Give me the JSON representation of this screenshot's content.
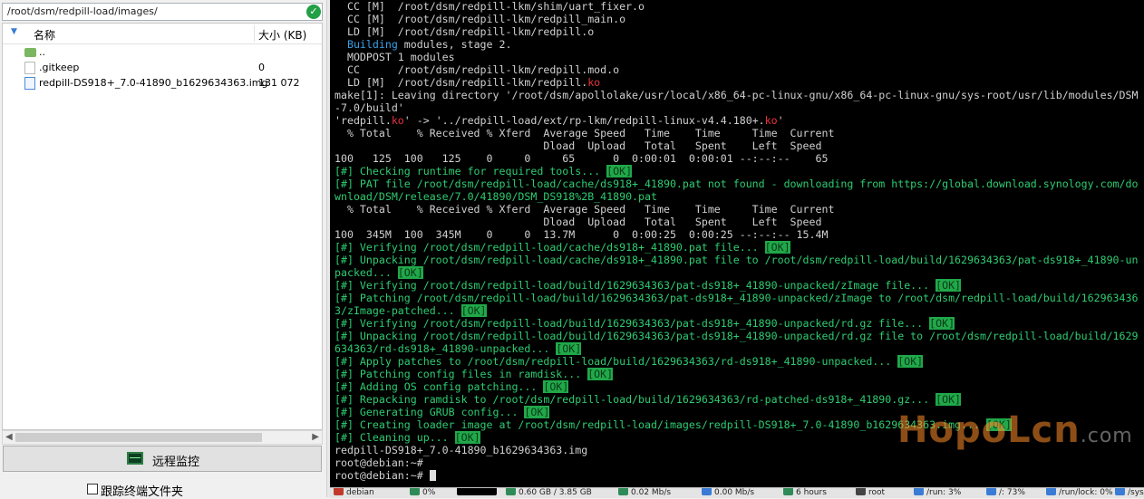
{
  "file_panel": {
    "path": "/root/dsm/redpill-load/images/",
    "columns": {
      "name": "名称",
      "size": "大小 (KB)"
    },
    "files": [
      {
        "name": "..",
        "size": "",
        "icon": "folder-up-icon"
      },
      {
        "name": ".gitkeep",
        "size": "0",
        "icon": "file-icon"
      },
      {
        "name": "redpill-DS918+_7.0-41890_b1629634363.img",
        "size": "131 072",
        "icon": "image-file-icon"
      }
    ],
    "remote_monitor_label": "远程监控",
    "follow_terminal_label": "跟踪终端文件夹"
  },
  "terminal": {
    "lines": [
      [
        {
          "t": "  CC [M]  /root/dsm/redpill-lkm/shim/uart_fixer.o"
        }
      ],
      [
        {
          "t": "  CC [M]  /root/dsm/redpill-lkm/redpill_main.o"
        }
      ],
      [
        {
          "t": "  LD [M]  /root/dsm/redpill-lkm/redpill.o"
        }
      ],
      [
        {
          "t": "  "
        },
        {
          "t": "Building",
          "c": "b"
        },
        {
          "t": " modules, stage 2."
        }
      ],
      [
        {
          "t": "  MODPOST 1 modules"
        }
      ],
      [
        {
          "t": "  CC      /root/dsm/redpill-lkm/redpill.mod.o"
        }
      ],
      [
        {
          "t": "  LD [M]  /root/dsm/redpill-lkm/redpill."
        },
        {
          "t": "ko",
          "c": "r"
        }
      ],
      [
        {
          "t": "make[1]: Leaving directory '/root/dsm/apollolake/usr/local/x86_64-pc-linux-gnu/x86_64-pc-linux-gnu/sys-root/usr/lib/modules/DSM"
        }
      ],
      [
        {
          "t": "-7.0/build'"
        }
      ],
      [
        {
          "t": "'redpill."
        },
        {
          "t": "ko",
          "c": "r"
        },
        {
          "t": "' -> '../redpill-load/ext/rp-lkm/redpill-linux-v4.4.180+."
        },
        {
          "t": "ko",
          "c": "r"
        },
        {
          "t": "'"
        }
      ],
      [
        {
          "t": "  % Total    % Received % Xferd  Average Speed   Time    Time     Time  Current"
        }
      ],
      [
        {
          "t": "                                 Dload  Upload   Total   Spent    Left  Speed"
        }
      ],
      [
        {
          "t": "100   125  100   125    0     0     65      0  0:00:01  0:00:01 --:--:--    65"
        }
      ],
      [
        {
          "t": "[#] Checking runtime for required tools... ",
          "c": "g"
        },
        {
          "t": "[OK]",
          "c": "okt"
        }
      ],
      [
        {
          "t": "[#] PAT file /root/dsm/redpill-load/cache/ds918+_41890.pat not found - downloading from https://global.download.synology.com/do",
          "c": "g"
        }
      ],
      [
        {
          "t": "wnload/DSM/release/7.0/41890/DSM_DS918%2B_41890.pat",
          "c": "g"
        }
      ],
      [
        {
          "t": "  % Total    % Received % Xferd  Average Speed   Time    Time     Time  Current"
        }
      ],
      [
        {
          "t": "                                 Dload  Upload   Total   Spent    Left  Speed"
        }
      ],
      [
        {
          "t": "100  345M  100  345M    0     0  13.7M      0  0:00:25  0:00:25 --:--:-- 15.4M"
        }
      ],
      [
        {
          "t": "[#] Verifying /root/dsm/redpill-load/cache/ds918+_41890.pat file... ",
          "c": "g"
        },
        {
          "t": "[OK]",
          "c": "okt"
        }
      ],
      [
        {
          "t": "[#] Unpacking /root/dsm/redpill-load/cache/ds918+_41890.pat file to /root/dsm/redpill-load/build/1629634363/pat-ds918+_41890-un",
          "c": "g"
        }
      ],
      [
        {
          "t": "packed... ",
          "c": "g"
        },
        {
          "t": "[OK]",
          "c": "okt"
        }
      ],
      [
        {
          "t": "[#] Verifying /root/dsm/redpill-load/build/1629634363/pat-ds918+_41890-unpacked/zImage file... ",
          "c": "g"
        },
        {
          "t": "[OK]",
          "c": "okt"
        }
      ],
      [
        {
          "t": "[#] Patching /root/dsm/redpill-load/build/1629634363/pat-ds918+_41890-unpacked/zImage to /root/dsm/redpill-load/build/162963436",
          "c": "g"
        }
      ],
      [
        {
          "t": "3/zImage-patched... ",
          "c": "g"
        },
        {
          "t": "[OK]",
          "c": "okt"
        }
      ],
      [
        {
          "t": "[#] Verifying /root/dsm/redpill-load/build/1629634363/pat-ds918+_41890-unpacked/rd.gz file... ",
          "c": "g"
        },
        {
          "t": "[OK]",
          "c": "okt"
        }
      ],
      [
        {
          "t": "[#] Unpacking /root/dsm/redpill-load/build/1629634363/pat-ds918+_41890-unpacked/rd.gz file to /root/dsm/redpill-load/build/1629",
          "c": "g"
        }
      ],
      [
        {
          "t": "634363/rd-ds918+_41890-unpacked... ",
          "c": "g"
        },
        {
          "t": "[OK]",
          "c": "okt"
        }
      ],
      [
        {
          "t": "[#] Apply patches to /root/dsm/redpill-load/build/1629634363/rd-ds918+_41890-unpacked... ",
          "c": "g"
        },
        {
          "t": "[OK]",
          "c": "okt"
        }
      ],
      [
        {
          "t": "[#] Patching config files in ramdisk... ",
          "c": "g"
        },
        {
          "t": "[OK]",
          "c": "okt"
        }
      ],
      [
        {
          "t": "[#] Adding OS config patching... ",
          "c": "g"
        },
        {
          "t": "[OK]",
          "c": "okt"
        }
      ],
      [
        {
          "t": "[#] Repacking ramdisk to /root/dsm/redpill-load/build/1629634363/rd-patched-ds918+_41890.gz... ",
          "c": "g"
        },
        {
          "t": "[OK]",
          "c": "okt"
        }
      ],
      [
        {
          "t": "[#] Generating GRUB config... ",
          "c": "g"
        },
        {
          "t": "[OK]",
          "c": "okt"
        }
      ],
      [
        {
          "t": "[#] Creating loader image at /root/dsm/redpill-load/images/redpill-DS918+_7.0-41890_b1629634363.img... ",
          "c": "g"
        },
        {
          "t": "[OK]",
          "c": "okt"
        }
      ],
      [
        {
          "t": "[#] Cleaning up... ",
          "c": "g"
        },
        {
          "t": "[OK]",
          "c": "okt"
        }
      ],
      [
        {
          "t": "redpill-DS918+_7.0-41890_b1629634363.img"
        }
      ],
      [
        {
          "t": "root@debian:~#"
        }
      ],
      [
        {
          "t": "root@debian:~# "
        },
        {
          "t": "",
          "c": "cursor"
        }
      ]
    ]
  },
  "watermark": {
    "main": "HopoLcn",
    "suffix": ".com"
  },
  "statusbar": {
    "items": [
      {
        "label": "debian",
        "icon": "server-icon",
        "color": "#c0392b"
      },
      {
        "label": "0%",
        "icon": "cpu-icon",
        "color": "#2e8b57"
      },
      {
        "label": "",
        "icon": "cpu-graph-icon",
        "color": "#000000"
      },
      {
        "label": "0.60 GB / 3.85 GB",
        "icon": "memory-icon",
        "color": "#2e8b57"
      },
      {
        "label": "0.02 Mb/s",
        "icon": "upload-icon",
        "color": "#2e8b57"
      },
      {
        "label": "0.00 Mb/s",
        "icon": "download-icon",
        "color": "#3a7bd5"
      },
      {
        "label": "6 hours",
        "icon": "clock-icon",
        "color": "#2e8b57"
      },
      {
        "label": "root",
        "icon": "user-icon",
        "color": "#444444"
      },
      {
        "label": "/run: 3%",
        "icon": "disk-icon",
        "color": "#3a7bd5"
      },
      {
        "label": "/: 73%",
        "icon": "disk-icon",
        "color": "#3a7bd5"
      },
      {
        "label": "/run/lock: 0%",
        "icon": "disk-icon",
        "color": "#3a7bd5"
      },
      {
        "label": "/sys/f",
        "icon": "disk-icon",
        "color": "#3a7bd5"
      }
    ]
  }
}
